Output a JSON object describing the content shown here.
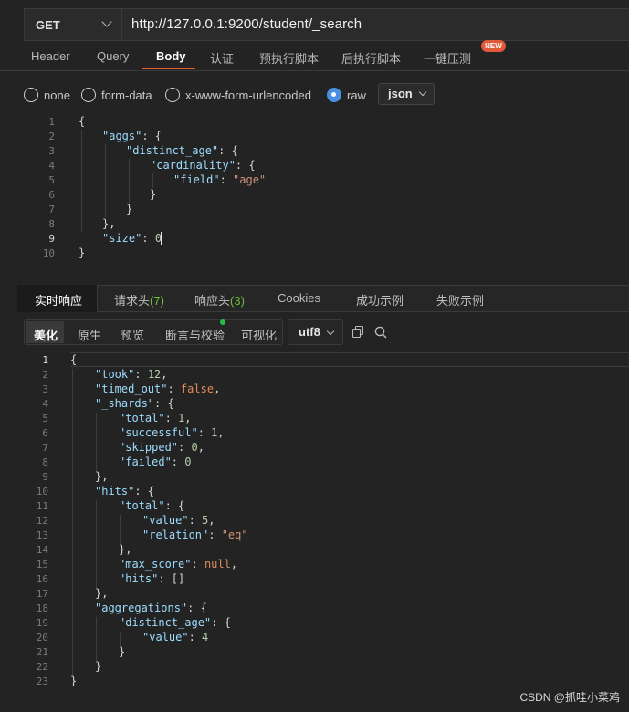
{
  "request": {
    "method": "GET",
    "url": "http://127.0.0.1:9200/student/_search"
  },
  "request_tabs": [
    "Header",
    "Query",
    "Body",
    "认证",
    "预执行脚本",
    "后执行脚本",
    "一键压测"
  ],
  "new_badge": "NEW",
  "body_types": [
    "none",
    "form-data",
    "x-www-form-urlencoded",
    "raw"
  ],
  "body_format": "json",
  "request_body_lines": [
    "1",
    "2",
    "3",
    "4",
    "5",
    "6",
    "7",
    "8",
    "9",
    "10"
  ],
  "response_tabs": {
    "realtime": "实时响应",
    "req_headers": "请求头",
    "req_headers_count": "(7)",
    "resp_headers": "响应头",
    "resp_headers_count": "(3)",
    "cookies": "Cookies",
    "success_example": "成功示例",
    "fail_example": "失败示例"
  },
  "view_modes": [
    "美化",
    "原生",
    "预览",
    "断言与校验",
    "可视化"
  ],
  "encoding": "utf8",
  "watermark": "CSDN @抓哇小菜鸡",
  "colors": {
    "accent": "#e0622e",
    "radio_checked": "#4a90e2",
    "count_green": "#6cbf3a"
  },
  "icons": [
    "chevron-down-icon",
    "copy-icon",
    "search-icon"
  ]
}
